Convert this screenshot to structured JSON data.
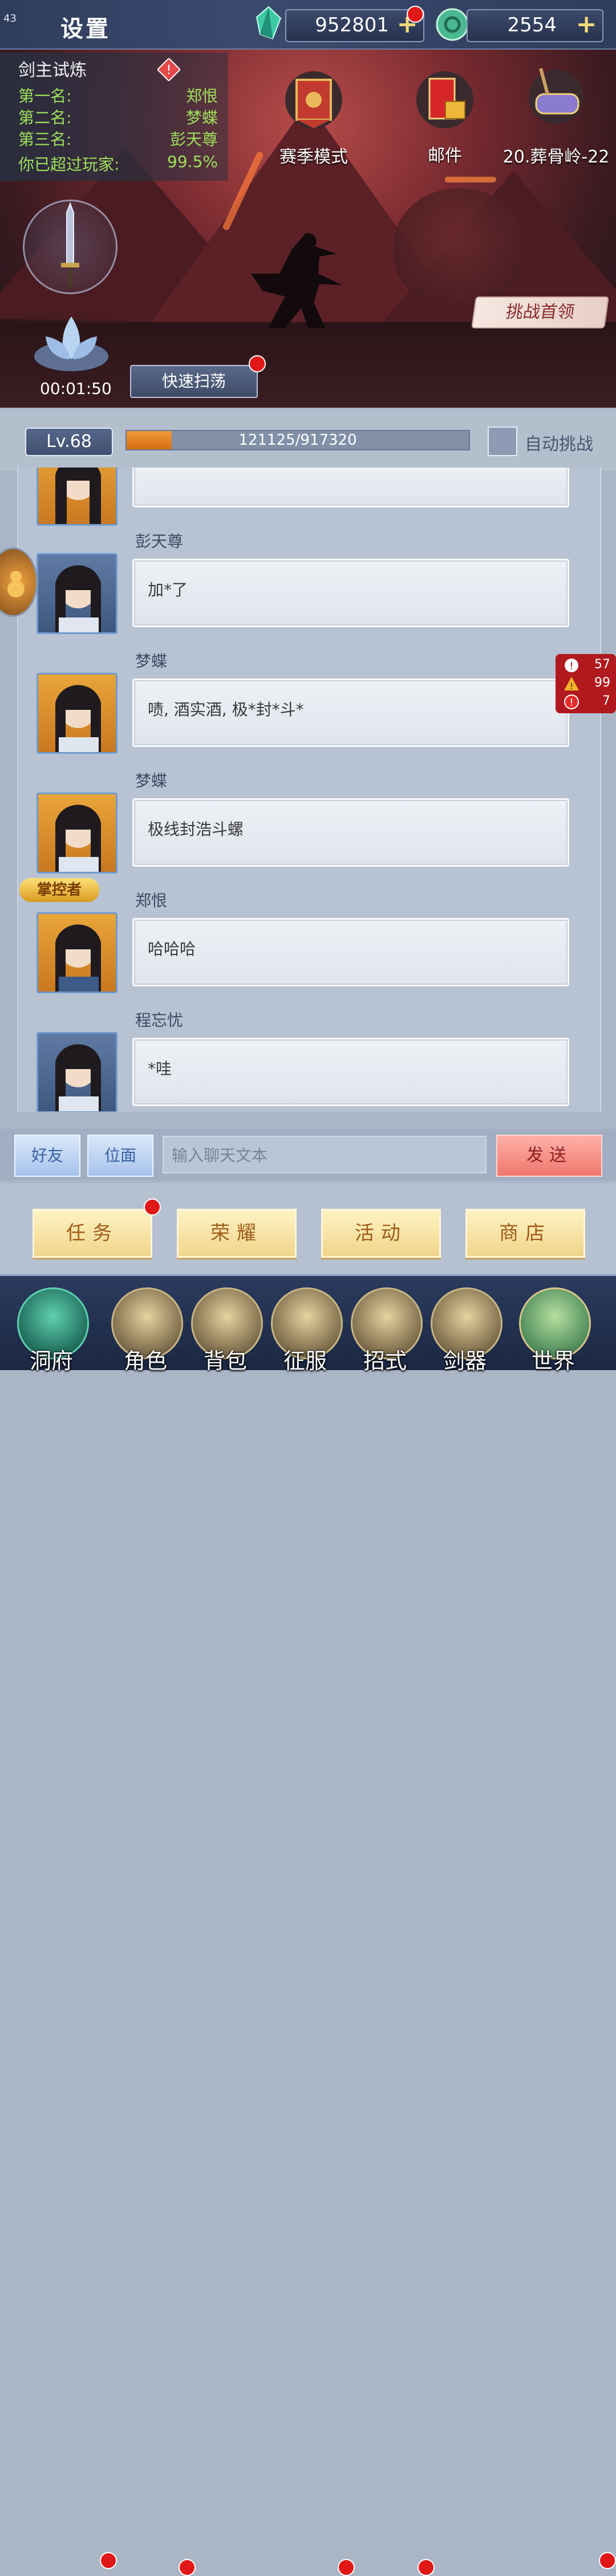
{
  "status": {
    "fps": "43"
  },
  "topbar": {
    "settings_label": "设置",
    "jade": "952801",
    "coin": "2554",
    "plus": "+"
  },
  "ranking": {
    "title": "剑主试炼",
    "labels": [
      "第一名:",
      "第二名:",
      "第三名:",
      "你已超过玩家:"
    ],
    "values": [
      "郑恨",
      "梦蝶",
      "彭天尊",
      "99.5%"
    ]
  },
  "menu": {
    "season": "赛季模式",
    "mail": "邮件",
    "stage": "20.葬骨岭-22"
  },
  "scene": {
    "challenge_boss": "挑战首领",
    "timer": "00:01:50",
    "quick_sweep": "快速扫荡"
  },
  "level": {
    "label": "Lv.68",
    "exp_text": "121125/917320",
    "exp_fraction": 0.132,
    "auto_label": "自动挑战"
  },
  "chat": {
    "messages": [
      {
        "name": "",
        "text": ""
      },
      {
        "name": "彭天尊",
        "text": "加*了"
      },
      {
        "name": "梦蝶",
        "text": "啧, 酒实酒, 极*封*斗*"
      },
      {
        "name": "梦蝶",
        "text": "极线封浩斗螺"
      },
      {
        "name": "郑恨",
        "text": "哈哈哈",
        "badge": "掌控者"
      },
      {
        "name": "程忘忧",
        "text": "*哇"
      }
    ]
  },
  "alerts": {
    "info": "57",
    "warn": "99",
    "error": "7"
  },
  "input": {
    "friends": "好友",
    "plane": "位面",
    "placeholder": "输入聊天文本",
    "send": "发送"
  },
  "functions": [
    "任务",
    "荣耀",
    "活动",
    "商店"
  ],
  "nav": [
    "洞府",
    "角色",
    "背包",
    "征服",
    "招式",
    "剑器",
    "世界"
  ],
  "colors": {
    "accent_green": "#9ee05a",
    "badge_red": "#e01818",
    "exp_orange": "#e07d1f"
  }
}
